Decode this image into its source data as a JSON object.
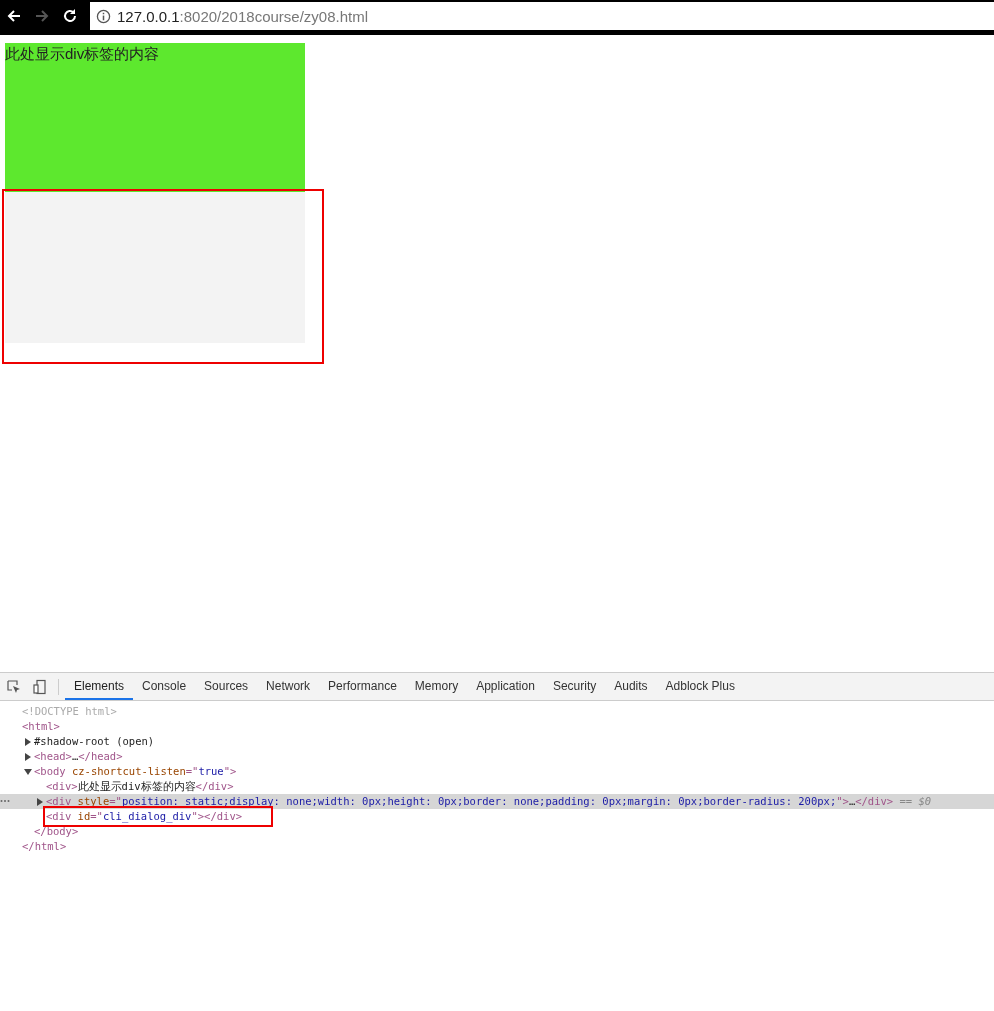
{
  "browser": {
    "url_host": "127.0.0.1",
    "url_rest": ":8020/2018course/zy08.html",
    "forward_disabled": true
  },
  "page": {
    "green_div": {
      "text": "此处显示div标签的内容",
      "color": "#5de82e"
    },
    "dialog_div": {
      "color": "#f3f3f3",
      "annotated": true
    }
  },
  "devtools": {
    "tabs": [
      {
        "label": "Elements",
        "selected": true
      },
      {
        "label": "Console",
        "selected": false
      },
      {
        "label": "Sources",
        "selected": false
      },
      {
        "label": "Network",
        "selected": false
      },
      {
        "label": "Performance",
        "selected": false
      },
      {
        "label": "Memory",
        "selected": false
      },
      {
        "label": "Application",
        "selected": false
      },
      {
        "label": "Security",
        "selected": false
      },
      {
        "label": "Audits",
        "selected": false
      },
      {
        "label": "Adblock Plus",
        "selected": false
      }
    ],
    "dom": [
      {
        "selected": false,
        "annotated": false,
        "segments": [
          {
            "kind": "comment",
            "text": "<!DOCTYPE html>"
          }
        ]
      },
      {
        "selected": false,
        "annotated": false,
        "segments": [
          {
            "kind": "tag",
            "text": "<html>"
          }
        ],
        "close": [
          {
            "kind": "tag",
            "text": "</html>"
          }
        ],
        "children": [
          {
            "expanded": false,
            "selected": false,
            "annotated": false,
            "segments": [
              {
                "kind": "text",
                "text": "#shadow-root (open)"
              }
            ]
          },
          {
            "expanded": false,
            "selected": false,
            "annotated": false,
            "segments": [
              {
                "kind": "tag",
                "text": "<head>"
              },
              {
                "kind": "text",
                "text": "…"
              },
              {
                "kind": "tag",
                "text": "</head>"
              }
            ]
          },
          {
            "expanded": true,
            "selected": false,
            "annotated": false,
            "segments": [
              {
                "kind": "tag",
                "text": "<body"
              },
              {
                "kind": "attr",
                "text": " cz-shortcut-listen"
              },
              {
                "kind": "tag",
                "text": "=\""
              },
              {
                "kind": "value",
                "text": "true"
              },
              {
                "kind": "tag",
                "text": "\">"
              }
            ],
            "close": [
              {
                "kind": "tag",
                "text": "</body>"
              }
            ],
            "children": [
              {
                "selected": false,
                "annotated": false,
                "segments": [
                  {
                    "kind": "tag",
                    "text": "<div>"
                  },
                  {
                    "kind": "text",
                    "text": "此处显示div标签的内容"
                  },
                  {
                    "kind": "tag",
                    "text": "</div>"
                  }
                ]
              },
              {
                "expanded": false,
                "selected": true,
                "annotated": false,
                "segments": [
                  {
                    "kind": "tag",
                    "text": "<div"
                  },
                  {
                    "kind": "attr",
                    "text": " style"
                  },
                  {
                    "kind": "tag",
                    "text": "=\""
                  },
                  {
                    "kind": "value",
                    "text": "position: static;display: none;width: 0px;height: 0px;border: none;padding: 0px;margin: 0px;border-radius: 200px;"
                  },
                  {
                    "kind": "tag",
                    "text": "\">"
                  },
                  {
                    "kind": "text",
                    "text": "…"
                  },
                  {
                    "kind": "tag",
                    "text": "</div>"
                  },
                  {
                    "kind": "note",
                    "text": " == $0"
                  }
                ]
              },
              {
                "selected": false,
                "annotated": true,
                "segments": [
                  {
                    "kind": "tag",
                    "text": "<div"
                  },
                  {
                    "kind": "attr",
                    "text": " id"
                  },
                  {
                    "kind": "tag",
                    "text": "=\""
                  },
                  {
                    "kind": "value",
                    "text": "cli_dialog_div"
                  },
                  {
                    "kind": "tag",
                    "text": "\">"
                  },
                  {
                    "kind": "tag",
                    "text": "</div>"
                  }
                ]
              }
            ]
          }
        ]
      }
    ]
  }
}
